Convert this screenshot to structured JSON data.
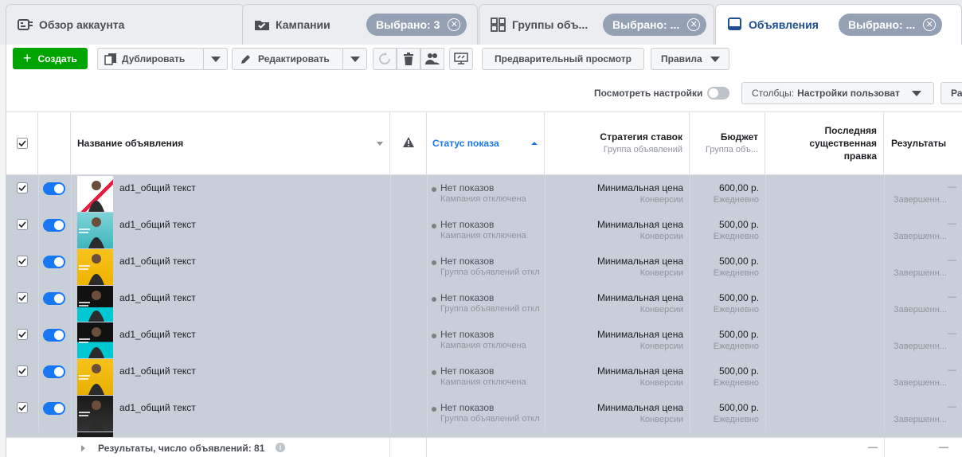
{
  "tabs": {
    "account": {
      "label": "Обзор аккаунта"
    },
    "campaigns": {
      "label": "Кампании",
      "pill": "Выбрано: 3"
    },
    "adsets": {
      "label": "Группы объ...",
      "pill": "Выбрано: ..."
    },
    "ads": {
      "label": "Объявления",
      "pill": "Выбрано: ..."
    }
  },
  "toolbar": {
    "create": "Создать",
    "duplicate": "Дублировать",
    "edit": "Редактировать",
    "preview": "Предварительный просмотр",
    "rules": "Правила",
    "view_settings": "Посмотреть настройки",
    "columns_label": "Столбцы:",
    "columns_value": "Настройки пользоват",
    "breakdown_partial": "Ра"
  },
  "table": {
    "headers": {
      "name": "Название объявления",
      "status": "Статус показа",
      "bid": "Стратегия ставок",
      "bid_sub": "Группа объявлений",
      "budget": "Бюджет",
      "budget_sub": "Группа объ...",
      "last_edit_1": "Последняя",
      "last_edit_2": "существенная",
      "last_edit_3": "правка",
      "results": "Результаты"
    },
    "rows": [
      {
        "name": "ad1_общий текст",
        "status": "Нет показов",
        "status_sub": "Кампания отключена",
        "bid": "Минимальная цена",
        "bid_sub": "Конверсии",
        "budget": "600,00 р.",
        "budget_sub": "Ежедневно",
        "result": "—",
        "result_sub": "Завершенн..."
      },
      {
        "name": "ad1_общий текст",
        "status": "Нет показов",
        "status_sub": "Кампания отключена",
        "bid": "Минимальная цена",
        "bid_sub": "Конверсии",
        "budget": "500,00 р.",
        "budget_sub": "Ежедневно",
        "result": "—",
        "result_sub": "Завершенн..."
      },
      {
        "name": "ad1_общий текст",
        "status": "Нет показов",
        "status_sub": "Группа объявлений откл",
        "bid": "Минимальная цена",
        "bid_sub": "Конверсии",
        "budget": "500,00 р.",
        "budget_sub": "Ежедневно",
        "result": "—",
        "result_sub": "Завершенн..."
      },
      {
        "name": "ad1_общий текст",
        "status": "Нет показов",
        "status_sub": "Группа объявлений откл",
        "bid": "Минимальная цена",
        "bid_sub": "Конверсии",
        "budget": "500,00 р.",
        "budget_sub": "Ежедневно",
        "result": "—",
        "result_sub": "Завершенн..."
      },
      {
        "name": "ad1_общий текст",
        "status": "Нет показов",
        "status_sub": "Кампания отключена",
        "bid": "Минимальная цена",
        "bid_sub": "Конверсии",
        "budget": "500,00 р.",
        "budget_sub": "Ежедневно",
        "result": "—",
        "result_sub": "Завершенн..."
      },
      {
        "name": "ad1_общий текст",
        "status": "Нет показов",
        "status_sub": "Кампания отключена",
        "bid": "Минимальная цена",
        "bid_sub": "Конверсии",
        "budget": "500,00 р.",
        "budget_sub": "Ежедневно",
        "result": "—",
        "result_sub": "Завершенн..."
      },
      {
        "name": "ad1_общий текст",
        "status": "Нет показов",
        "status_sub": "Группа объявлений откл",
        "bid": "Минимальная цена",
        "bid_sub": "Конверсии",
        "budget": "500,00 р.",
        "budget_sub": "Ежедневно",
        "result": "—",
        "result_sub": "Завершенн..."
      }
    ],
    "footer": {
      "label": "Результаты, число объявлений: 81",
      "dash1": "—",
      "dash2": "—"
    }
  },
  "colors": {
    "accent": "#1877f2",
    "create_green": "#00a400",
    "active_tab_text": "#1d4f91",
    "selected_row": "#c9cfd9"
  }
}
